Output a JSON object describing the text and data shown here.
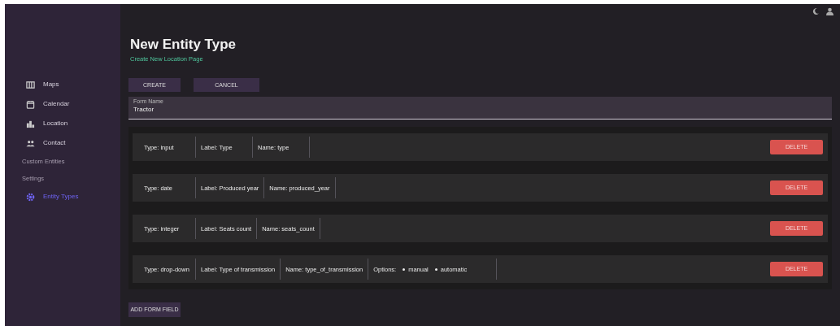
{
  "sidebar": {
    "items": [
      {
        "kind": "link",
        "label": "Maps",
        "selected": false
      },
      {
        "kind": "link",
        "label": "Calendar",
        "selected": false
      },
      {
        "kind": "link",
        "label": "Location",
        "selected": false
      },
      {
        "kind": "link",
        "label": "Contact",
        "selected": false
      },
      {
        "kind": "section",
        "label": "Custom Entities"
      },
      {
        "kind": "section",
        "label": "Settings",
        "children": [
          {
            "kind": "link",
            "label": "Entity Types",
            "selected": true
          }
        ]
      }
    ]
  },
  "page": {
    "title": "New Entity Type",
    "subtitle": "Create New Location Page"
  },
  "actions": [
    "CREATE",
    "CANCEL"
  ],
  "form_name": {
    "label": "Form Name",
    "value": "Tractor"
  },
  "fields": [
    {
      "type": "Type: input",
      "label": "Label: Type",
      "name": "Name: type",
      "button": "DELETE"
    },
    {
      "type": "Type: date",
      "label": "Label: Produced year",
      "name": "Name: produced_year",
      "button": "DELETE"
    },
    {
      "type": "Type: integer",
      "label": "Label: Seats count",
      "name": "Name: seats_count",
      "button": "DELETE"
    },
    {
      "type": "Type: drop-down",
      "label": "Label: Type of transmission",
      "name": "Name: type_of_transmission",
      "options_label": "Options:",
      "options": [
        "manual",
        "automatic"
      ],
      "button": "DELETE"
    }
  ],
  "add_button": "ADD FORM FIELD"
}
